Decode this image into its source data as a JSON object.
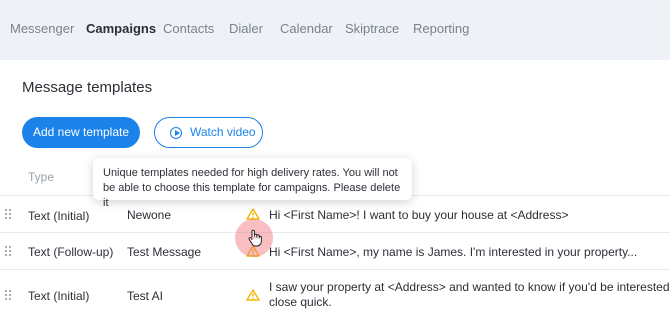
{
  "nav": {
    "tabs": [
      {
        "label": "Messenger"
      },
      {
        "label": "Campaigns",
        "active": true
      },
      {
        "label": "Contacts"
      },
      {
        "label": "Dialer"
      },
      {
        "label": "Calendar"
      },
      {
        "label": "Skiptrace"
      },
      {
        "label": "Reporting"
      }
    ]
  },
  "page": {
    "title": "Message templates",
    "add_button": "Add new template",
    "video_button": "Watch video"
  },
  "table": {
    "columns": {
      "type": "Type"
    },
    "rows": [
      {
        "type": "Text (Initial)",
        "name": "Newone",
        "message": "Hi <First Name>! I want to buy your house at <Address>",
        "warning_icon": "warning-triangle-icon"
      },
      {
        "type": "Text (Follow-up)",
        "name": "Test Message",
        "message": "Hi <First Name>, my name is James. I'm interested in your property...",
        "warning_icon": "warning-triangle-icon"
      },
      {
        "type": "Text (Initial)",
        "name": "Test AI",
        "message": "I saw your property at <Address> and wanted to know if you'd be interested in selling.",
        "message_line2": "close quick.",
        "warning_icon": "warning-triangle-icon"
      }
    ]
  },
  "tooltip": {
    "text": "Unique templates needed for high delivery rates. You will not be able to choose this template for campaigns. Please delete it"
  },
  "colors": {
    "accent": "#1a82e8",
    "warning": "#f2b600",
    "nav_bg": "#eef1f5"
  }
}
